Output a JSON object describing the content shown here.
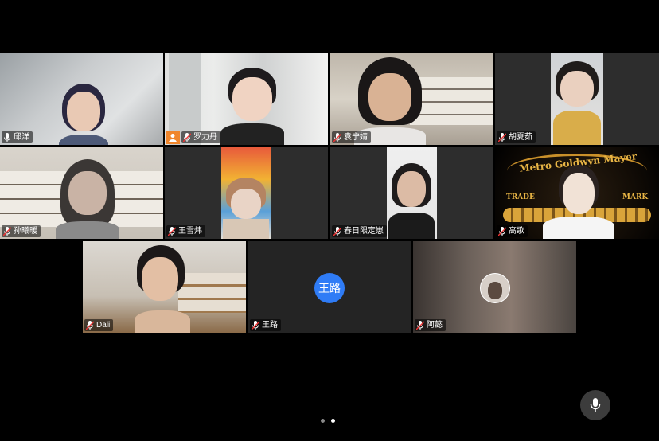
{
  "participants": [
    {
      "name": "邱洋",
      "muted": false
    },
    {
      "name": "罗力丹",
      "muted": true
    },
    {
      "name": "袁宁婧",
      "muted": true
    },
    {
      "name": "胡夏茹",
      "muted": true
    },
    {
      "name": "孙曦暖",
      "muted": true
    },
    {
      "name": "王雪炜",
      "muted": true
    },
    {
      "name": "春日限定崽",
      "muted": true
    },
    {
      "name": "高歌",
      "muted": true
    },
    {
      "name": "Dali",
      "muted": true
    },
    {
      "name": "王路",
      "muted": true,
      "avatar_text": "王路"
    },
    {
      "name": "阿懿",
      "muted": true
    }
  ],
  "background_tile": {
    "line1": "Metro Goldwyn Mayer",
    "left": "TRADE",
    "right": "MARK"
  },
  "pager": {
    "pages": 2,
    "current": 2
  },
  "colors": {
    "active_border": "#6ee06e",
    "host_badge": "#f0862c",
    "avatar_blue": "#2f7cf6"
  }
}
